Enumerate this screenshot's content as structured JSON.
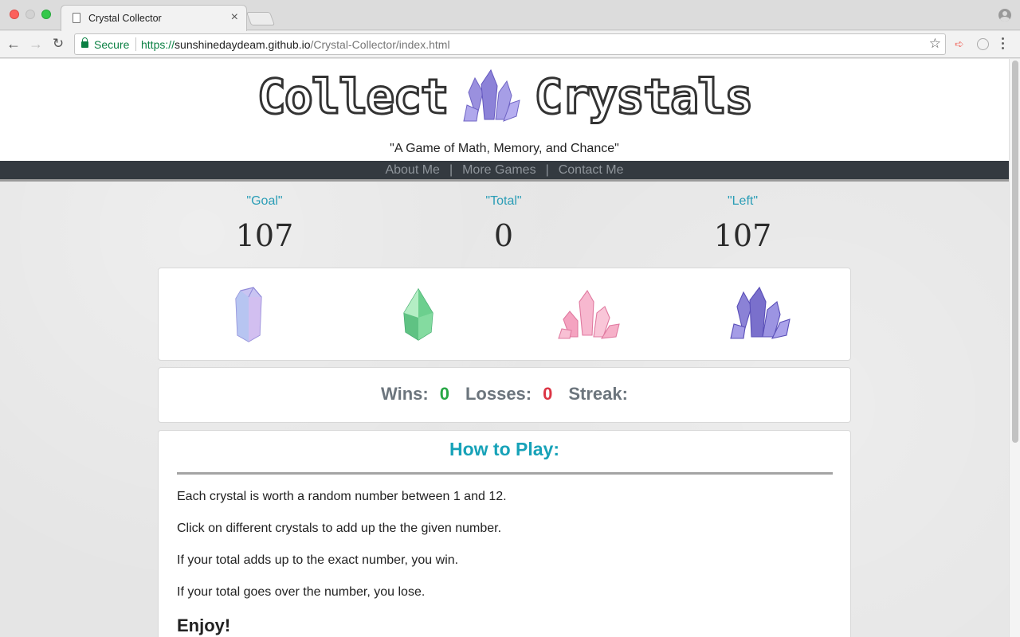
{
  "browser": {
    "tab_title": "Crystal Collector",
    "tab_close": "×",
    "secure_label": "Secure",
    "url_scheme": "https://",
    "url_host": "sunshinedaydeam.github.io",
    "url_path": "/Crystal-Collector/index.html"
  },
  "header": {
    "logo_left": "Collect",
    "logo_right": "Crystals",
    "tagline": "\"A Game of Math, Memory, and Chance\""
  },
  "nav": {
    "items": [
      "About Me",
      "More Games",
      "Contact Me"
    ],
    "separator": "|"
  },
  "stats": {
    "goal_label": "\"Goal\"",
    "goal_value": "107",
    "total_label": "\"Total\"",
    "total_value": "0",
    "left_label": "\"Left\"",
    "left_value": "107"
  },
  "crystals": [
    {
      "name": "blue-prism-crystal",
      "color": "#a9a6e8"
    },
    {
      "name": "green-drop-crystal",
      "color": "#6fcf8e"
    },
    {
      "name": "pink-cluster-crystal",
      "color": "#f2a6c0"
    },
    {
      "name": "purple-cluster-crystal",
      "color": "#7d74d4"
    }
  ],
  "score": {
    "wins_label": "Wins:",
    "wins_value": "0",
    "losses_label": "Losses:",
    "losses_value": "0",
    "streak_label": "Streak:"
  },
  "howto": {
    "title": "How to Play:",
    "lines": [
      "Each crystal is worth a random number between 1 and 12.",
      "Click on different crystals to add up the the given number.",
      "If your total adds up to the exact number, you win.",
      "If your total goes over the number, you lose."
    ],
    "closing": "Enjoy!"
  },
  "colors": {
    "accent": "#17a2b8",
    "win": "#28a745",
    "loss": "#dc3545",
    "navbar": "#343a40"
  }
}
